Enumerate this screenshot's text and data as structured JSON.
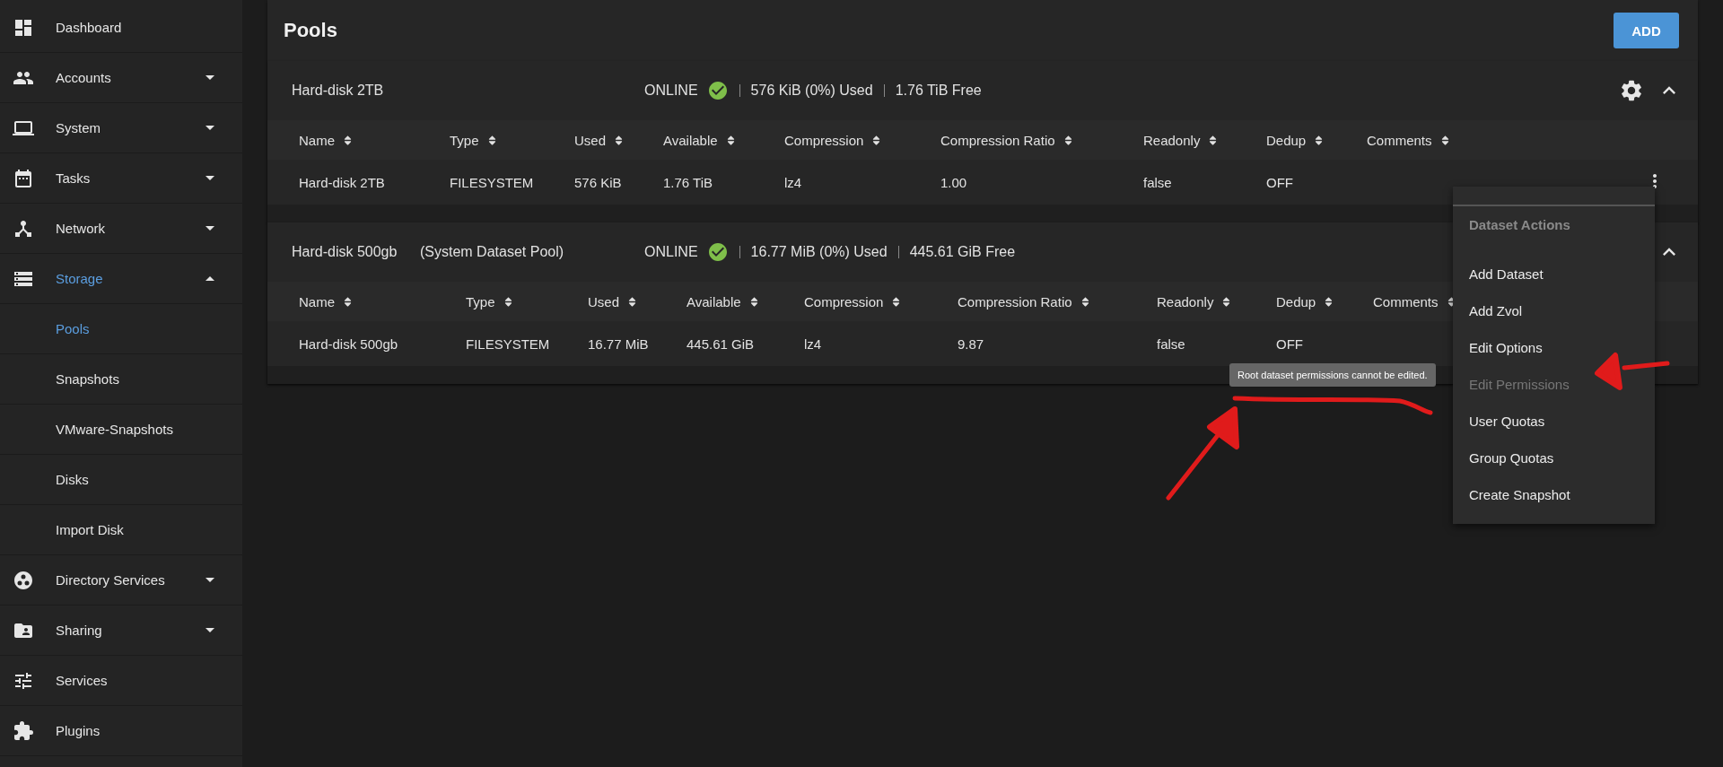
{
  "sidebar": {
    "items": [
      {
        "label": "Dashboard",
        "kind": "link",
        "selected": false
      },
      {
        "label": "Accounts",
        "kind": "menu",
        "expanded": false,
        "selected": false
      },
      {
        "label": "System",
        "kind": "menu",
        "expanded": false,
        "selected": false
      },
      {
        "label": "Tasks",
        "kind": "menu",
        "expanded": false,
        "selected": false
      },
      {
        "label": "Network",
        "kind": "menu",
        "expanded": false,
        "selected": false
      },
      {
        "label": "Storage",
        "kind": "menu",
        "expanded": true,
        "selected": true,
        "children": [
          {
            "label": "Pools",
            "selected": true
          },
          {
            "label": "Snapshots",
            "selected": false
          },
          {
            "label": "VMware-Snapshots",
            "selected": false
          },
          {
            "label": "Disks",
            "selected": false
          },
          {
            "label": "Import Disk",
            "selected": false
          }
        ]
      },
      {
        "label": "Directory Services",
        "kind": "menu",
        "expanded": false,
        "selected": false
      },
      {
        "label": "Sharing",
        "kind": "menu",
        "expanded": false,
        "selected": false
      },
      {
        "label": "Services",
        "kind": "link",
        "selected": false
      },
      {
        "label": "Plugins",
        "kind": "link",
        "selected": false
      }
    ]
  },
  "page": {
    "title": "Pools",
    "add_button": "ADD"
  },
  "pools": [
    {
      "name": "Hard-disk 2TB",
      "status": "ONLINE",
      "healthy": true,
      "used": "576 KiB (0%) Used",
      "free": "1.76 TiB Free",
      "expanded": true,
      "columns": [
        "Name",
        "Type",
        "Used",
        "Available",
        "Compression",
        "Compression Ratio",
        "Readonly",
        "Dedup",
        "Comments"
      ],
      "rows": [
        [
          "Hard-disk 2TB",
          "FILESYSTEM",
          "576 KiB",
          "1.76 TiB",
          "lz4",
          "1.00",
          "false",
          "OFF",
          ""
        ]
      ]
    },
    {
      "name": "Hard-disk 500gb",
      "subtitle": "(System Dataset Pool)",
      "status": "ONLINE",
      "healthy": true,
      "used": "16.77 MiB (0%) Used",
      "free": "445.61 GiB Free",
      "expanded": true,
      "columns": [
        "Name",
        "Type",
        "Used",
        "Available",
        "Compression",
        "Compression Ratio",
        "Readonly",
        "Dedup",
        "Comments"
      ],
      "rows": [
        [
          "Hard-disk 500gb",
          "FILESYSTEM",
          "16.77 MiB",
          "445.61 GiB",
          "lz4",
          "9.87",
          "false",
          "OFF",
          ""
        ]
      ]
    }
  ],
  "menu": {
    "title": "Dataset Actions",
    "items": [
      {
        "label": "Add Dataset",
        "disabled": false
      },
      {
        "label": "Add Zvol",
        "disabled": false
      },
      {
        "label": "Edit Options",
        "disabled": false
      },
      {
        "label": "Edit Permissions",
        "disabled": true
      },
      {
        "label": "User Quotas",
        "disabled": false
      },
      {
        "label": "Group Quotas",
        "disabled": false
      },
      {
        "label": "Create Snapshot",
        "disabled": false
      }
    ]
  },
  "tooltip": "Root dataset permissions cannot be edited."
}
